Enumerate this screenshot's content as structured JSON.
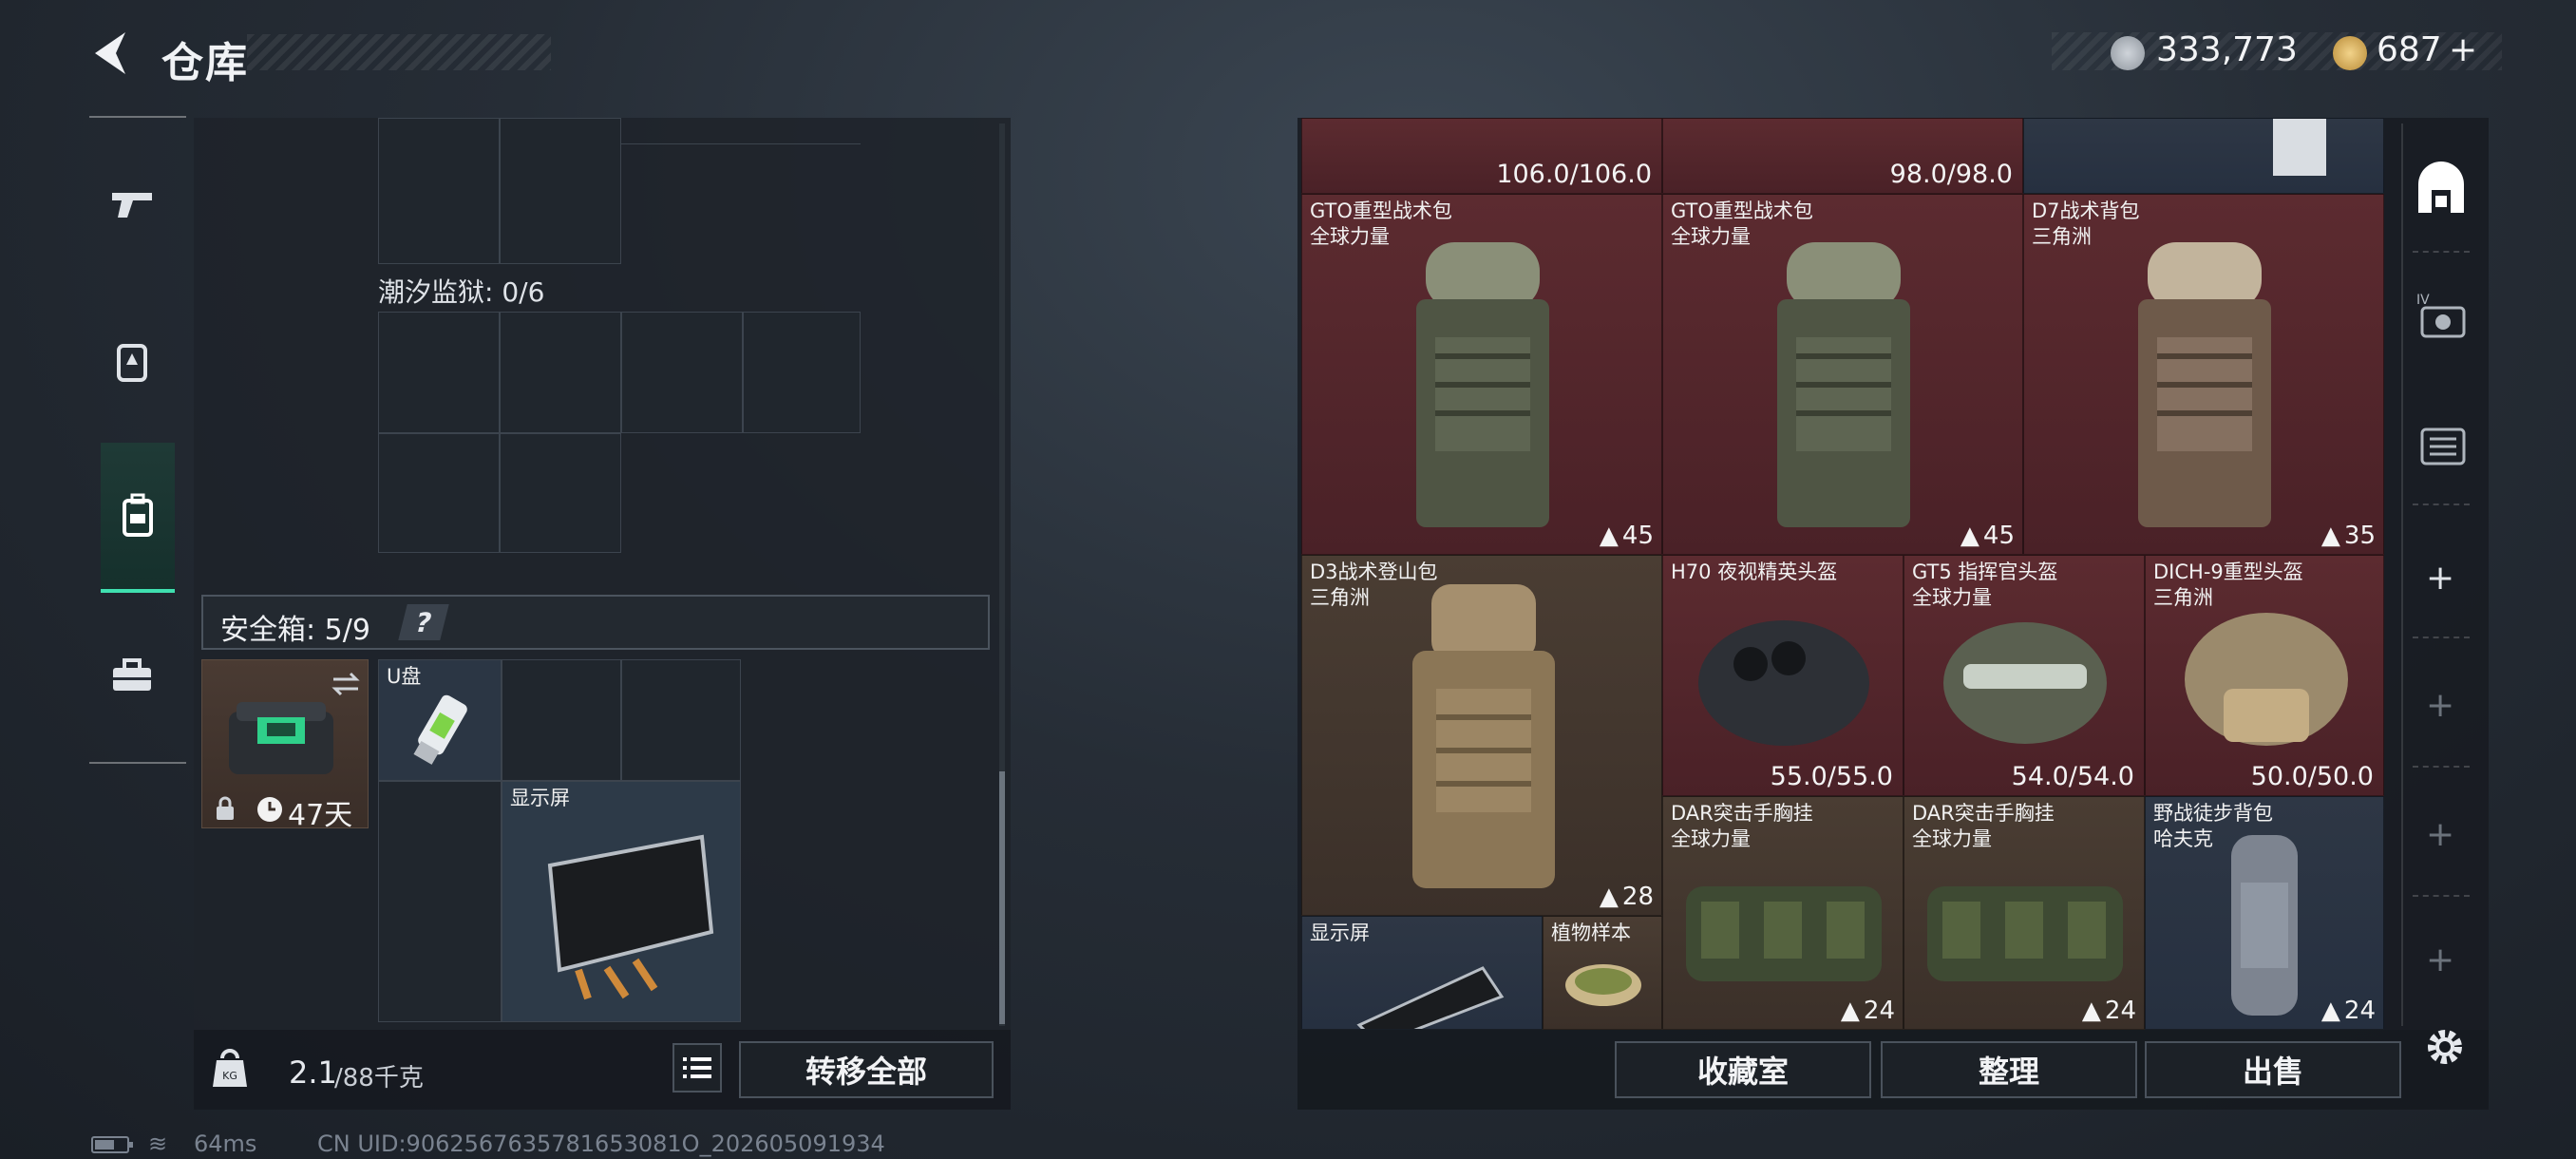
{
  "header": {
    "title": "仓库",
    "currency_silver": "333,773",
    "currency_gold": "687",
    "gold_plus": "+"
  },
  "left": {
    "tide_prison": "潮汐监狱: 0/6",
    "safe_box": "安全箱: 5/9",
    "help": "?",
    "safe_case_days": "47天",
    "items": [
      {
        "name": "U盘"
      },
      {
        "name": "显示屏"
      }
    ],
    "weight_value": "2.1",
    "weight_max": "/88千克",
    "transfer_all": "转移全部"
  },
  "right": {
    "top_values": [
      "106.0/106.0",
      "98.0/98.0"
    ],
    "items": [
      {
        "name": "GTO重型战术包",
        "origin": "全球力量",
        "count": "45"
      },
      {
        "name": "GTO重型战术包",
        "origin": "全球力量",
        "count": "45"
      },
      {
        "name": "D7战术背包",
        "origin": "三角洲",
        "count": "35"
      },
      {
        "name": "D3战术登山包",
        "origin": "三角洲",
        "count": "28"
      },
      {
        "name": "H70 夜视精英头盔",
        "origin": "",
        "value": "55.0/55.0"
      },
      {
        "name": "GT5 指挥官头盔",
        "origin": "全球力量",
        "value": "54.0/54.0"
      },
      {
        "name": "DICH-9重型头盔",
        "origin": "三角洲",
        "value": "50.0/50.0"
      },
      {
        "name": "DAR突击手胸挂",
        "origin": "全球力量",
        "count": "24"
      },
      {
        "name": "DAR突击手胸挂",
        "origin": "全球力量",
        "count": "24"
      },
      {
        "name": "野战徒步背包",
        "origin": "哈夫克",
        "count": "24"
      },
      {
        "name": "显示屏",
        "origin": ""
      },
      {
        "name": "植物样本",
        "origin": ""
      }
    ],
    "buttons": {
      "collection": "收藏室",
      "organize": "整理",
      "sell": "出售"
    }
  },
  "status": {
    "ping": "64ms",
    "uid": "CN UID:9062567635781653081O_202605091934"
  },
  "colors": {
    "accent": "#3fe0b0",
    "red_item": "#5c2b30",
    "brown_item": "#4a3d33",
    "blue_item": "#2e3745"
  }
}
